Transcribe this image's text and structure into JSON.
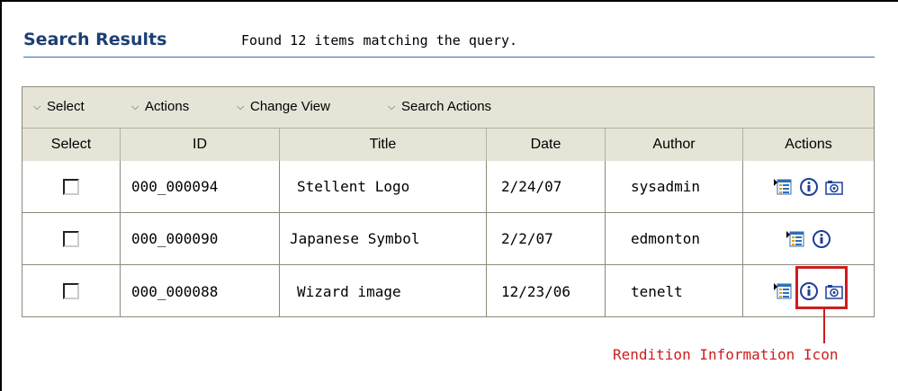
{
  "header": {
    "title": "Search Results",
    "subtitle": "Found 12 items matching the query."
  },
  "toolbar": {
    "items": [
      {
        "label": "Select",
        "icon": "chevron-down-icon"
      },
      {
        "label": "Actions",
        "icon": "chevron-down-icon"
      },
      {
        "label": "Change View",
        "icon": "chevron-down-icon"
      },
      {
        "label": "Search Actions",
        "icon": "chevron-down-icon"
      }
    ]
  },
  "table": {
    "columns": [
      "Select",
      "ID",
      "Title",
      "Date",
      "Author",
      "Actions"
    ],
    "rows": [
      {
        "id": "000_000094",
        "title": "Stellent Logo",
        "date": "2/24/07",
        "author": "sysadmin",
        "actions": [
          "content-info-icon",
          "info-icon",
          "rendition-info-icon"
        ]
      },
      {
        "id": "000_000090",
        "title": "Japanese Symbol",
        "date": "2/2/07",
        "author": "edmonton",
        "actions": [
          "content-info-icon",
          "info-icon"
        ]
      },
      {
        "id": "000_000088",
        "title": "Wizard image",
        "date": "12/23/06",
        "author": "tenelt",
        "actions": [
          "content-info-icon",
          "info-icon",
          "rendition-info-icon"
        ]
      }
    ]
  },
  "callout": {
    "label": "Rendition Information Icon",
    "color": "#cc1d1d"
  },
  "colors": {
    "title": "#1d3f73",
    "toolbar_bg": "#e5e4d6",
    "header_rule": "#2f6fb7"
  }
}
